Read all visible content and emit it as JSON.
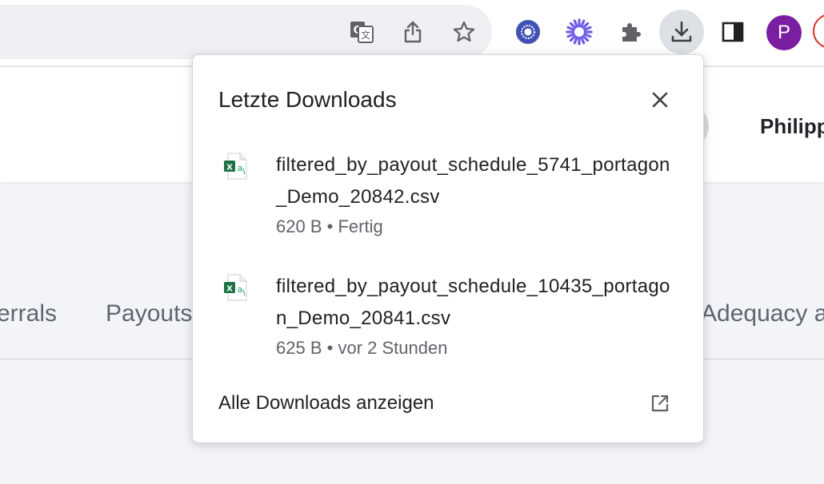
{
  "toolbar": {
    "icons": [
      "translate-icon",
      "share-icon",
      "bookmark-star-icon",
      "extension-circle-icon",
      "extension-burst-icon",
      "extensions-puzzle-icon",
      "downloads-icon",
      "side-panel-icon"
    ],
    "profile_initial": "P"
  },
  "page": {
    "user_name": "Philipp",
    "tabs": [
      "errals",
      "Payouts",
      "Adequacy a"
    ]
  },
  "downloads": {
    "title": "Letzte Downloads",
    "items": [
      {
        "name": "filtered_by_payout_schedule_5741_portagon_Demo_20842.csv",
        "size": "620 B",
        "separator": "•",
        "status": "Fertig"
      },
      {
        "name": "filtered_by_payout_schedule_10435_portagon_Demo_20841.csv",
        "size": "625 B",
        "separator": "•",
        "status": "vor 2 Stunden"
      }
    ],
    "show_all_label": "Alle Downloads anzeigen"
  },
  "colors": {
    "accent_purple": "#7b1fa2",
    "burst_purple": "#6c5ce7",
    "excel_green": "#1e7145"
  }
}
